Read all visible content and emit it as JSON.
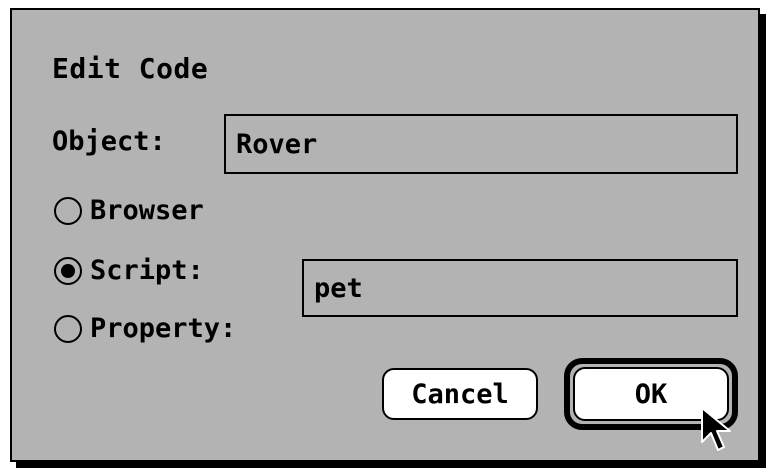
{
  "dialog": {
    "title": "Edit Code",
    "object": {
      "label": "Object:",
      "value": "Rover"
    },
    "options": [
      {
        "label": "Browser",
        "checked": false
      },
      {
        "label": "Script:",
        "checked": true
      },
      {
        "label": "Property:",
        "checked": false
      }
    ],
    "name_field": {
      "value": "pet"
    },
    "buttons": {
      "cancel": "Cancel",
      "ok": "OK",
      "default": "ok"
    }
  },
  "colors": {
    "dialog_background": "#b3b3b3",
    "button_background": "#ffffff",
    "border": "#000000"
  },
  "cursor_icon": "arrow-pointer-icon"
}
